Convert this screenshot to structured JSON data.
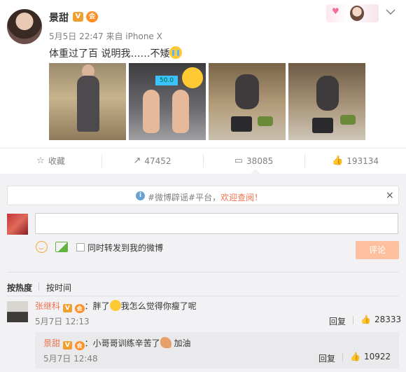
{
  "post": {
    "username": "景甜",
    "vip_badge": "V",
    "member_badge": "会",
    "meta": "5月5日 22:47 来自 iPhone X",
    "text": "体重过了百 说明我……不矮",
    "photos": [
      {
        "scale_readout": "50.0"
      }
    ]
  },
  "actions": {
    "favorite": "收藏",
    "repost_count": "47452",
    "comment_count": "38085",
    "like_count": "193134"
  },
  "notice": {
    "prefix": "#微博辟谣#平台，",
    "link": "欢迎查阅！",
    "close": "×"
  },
  "composer": {
    "input_value": "",
    "repost_label": "同时转发到我的微博",
    "submit_label": "评论"
  },
  "sort": {
    "hot": "按热度",
    "time": "按时间"
  },
  "comments": [
    {
      "user": "张继科",
      "text_before": "：胖了",
      "text_after": "我怎么觉得你瘦了呢",
      "date": "5月7日 12:13",
      "reply_label": "回复",
      "likes": "28333",
      "reply": {
        "user": "景甜",
        "text_before": "：小哥哥训练辛苦了",
        "text_after": " 加油",
        "date": "5月7日 12:48",
        "reply_label": "回复",
        "likes": "10922"
      }
    }
  ],
  "colors": {
    "accent": "#eb7350",
    "submit_bg": "#ffc09f",
    "panel_bg": "#f2f2f5"
  },
  "icons": {
    "favorite": "star-icon",
    "repost": "repost-icon",
    "comment": "comment-icon",
    "like": "thumb-up-icon",
    "notice": "info-icon",
    "emoji": "smile-icon",
    "image": "image-icon"
  }
}
